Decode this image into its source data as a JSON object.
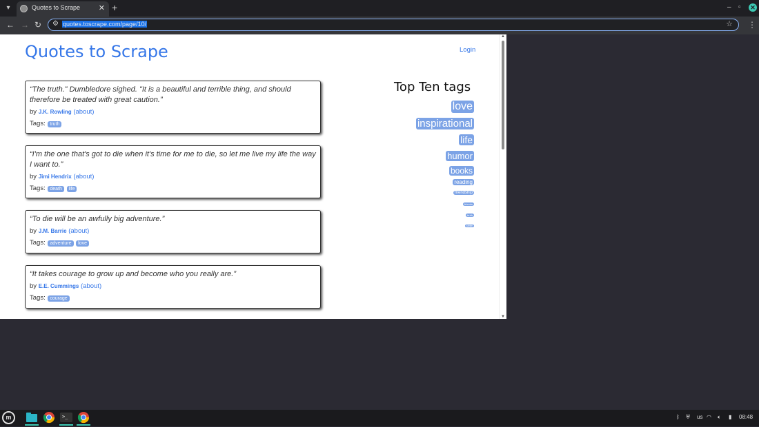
{
  "browser": {
    "tab_title": "Quotes to Scrape",
    "url": "quotes.toscrape.com/page/10/"
  },
  "site": {
    "title": "Quotes to Scrape",
    "login": "Login"
  },
  "quotes": [
    {
      "text": "“The truth.” Dumbledore sighed. \"It is a beautiful and terrible thing, and should therefore be treated with great caution.”",
      "by": "by",
      "author": "J.K. Rowling",
      "about": "(about)",
      "tags_label": "Tags:",
      "tags": [
        "truth"
      ]
    },
    {
      "text": "“I'm the one that's got to die when it's time for me to die, so let me live my life the way I want to.”",
      "by": "by",
      "author": "Jimi Hendrix",
      "about": "(about)",
      "tags_label": "Tags:",
      "tags": [
        "death",
        "life"
      ]
    },
    {
      "text": "“To die will be an awfully big adventure.”",
      "by": "by",
      "author": "J.M. Barrie",
      "about": "(about)",
      "tags_label": "Tags:",
      "tags": [
        "adventure",
        "love"
      ]
    },
    {
      "text": "“It takes courage to grow up and become who you really are.”",
      "by": "by",
      "author": "E.E. Cummings",
      "about": "(about)",
      "tags_label": "Tags:",
      "tags": [
        "courage"
      ]
    }
  ],
  "top_tags": {
    "title": "Top Ten tags",
    "items": [
      "love",
      "inspirational",
      "life",
      "humor",
      "books",
      "reading",
      "friendship",
      "friends",
      "truth",
      "simile"
    ]
  },
  "taskbar": {
    "keyboard_layout": "us",
    "clock": "08:48"
  },
  "colors": {
    "link": "#3677e8",
    "tag_bg": "#7ca3e6",
    "accent": "#3cc9b3"
  }
}
